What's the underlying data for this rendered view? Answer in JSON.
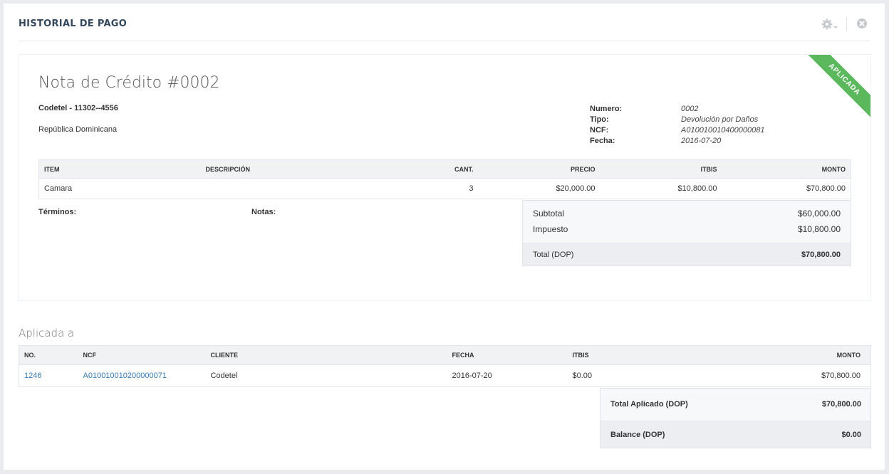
{
  "header": {
    "title": "HISTORIAL DE PAGO",
    "actions": [
      {
        "icon": "gear-icon"
      },
      {
        "icon": "close-icon"
      }
    ]
  },
  "invoice": {
    "ribbon": "APLICADA",
    "ribbon_color": "#5cb85c",
    "title": "Nota de Crédito #0002",
    "client": "Codetel - 11302--4556",
    "country": "República Dominicana",
    "meta": {
      "numero_label": "Numero:",
      "numero": "0002",
      "tipo_label": "Tipo:",
      "tipo": "Devolución por Daños",
      "ncf_label": "NCF:",
      "ncf": "A010010010400000081",
      "fecha_label": "Fecha:",
      "fecha": "2016-07-20"
    },
    "items_headers": {
      "item": "ITEM",
      "descripcion": "DESCRIPCIÓN",
      "cant": "CANT.",
      "precio": "PRECIO",
      "itbis": "ITBIS",
      "monto": "MONTO"
    },
    "items": [
      {
        "item": "Camara",
        "descripcion": "",
        "cant": "3",
        "precio": "$20,000.00",
        "itbis": "$10,800.00",
        "monto": "$70,800.00"
      }
    ],
    "terms_label": "Términos:",
    "notes_label": "Notas:",
    "totals": {
      "subtotal_label": "Subtotal",
      "subtotal": "$60,000.00",
      "impuesto_label": "Impuesto",
      "impuesto": "$10,800.00",
      "total_label": "Total (DOP)",
      "total": "$70,800.00"
    }
  },
  "applied": {
    "heading": "Aplicada a",
    "headers": {
      "no": "NO.",
      "ncf": "NCF",
      "cliente": "CLIENTE",
      "fecha": "FECHA",
      "itbis": "ITBIS",
      "monto": "MONTO"
    },
    "rows": [
      {
        "no": "1246",
        "ncf": "A010010010200000071",
        "cliente": "Codetel",
        "fecha": "2016-07-20",
        "itbis": "$0.00",
        "monto": "$70,800.00"
      }
    ],
    "summary": {
      "total_aplicado_label": "Total Aplicado (DOP)",
      "total_aplicado": "$70,800.00",
      "balance_label": "Balance (DOP)",
      "balance": "$0.00"
    }
  },
  "colors": {
    "link": "#337ab7",
    "accent": "#5cb85c"
  }
}
